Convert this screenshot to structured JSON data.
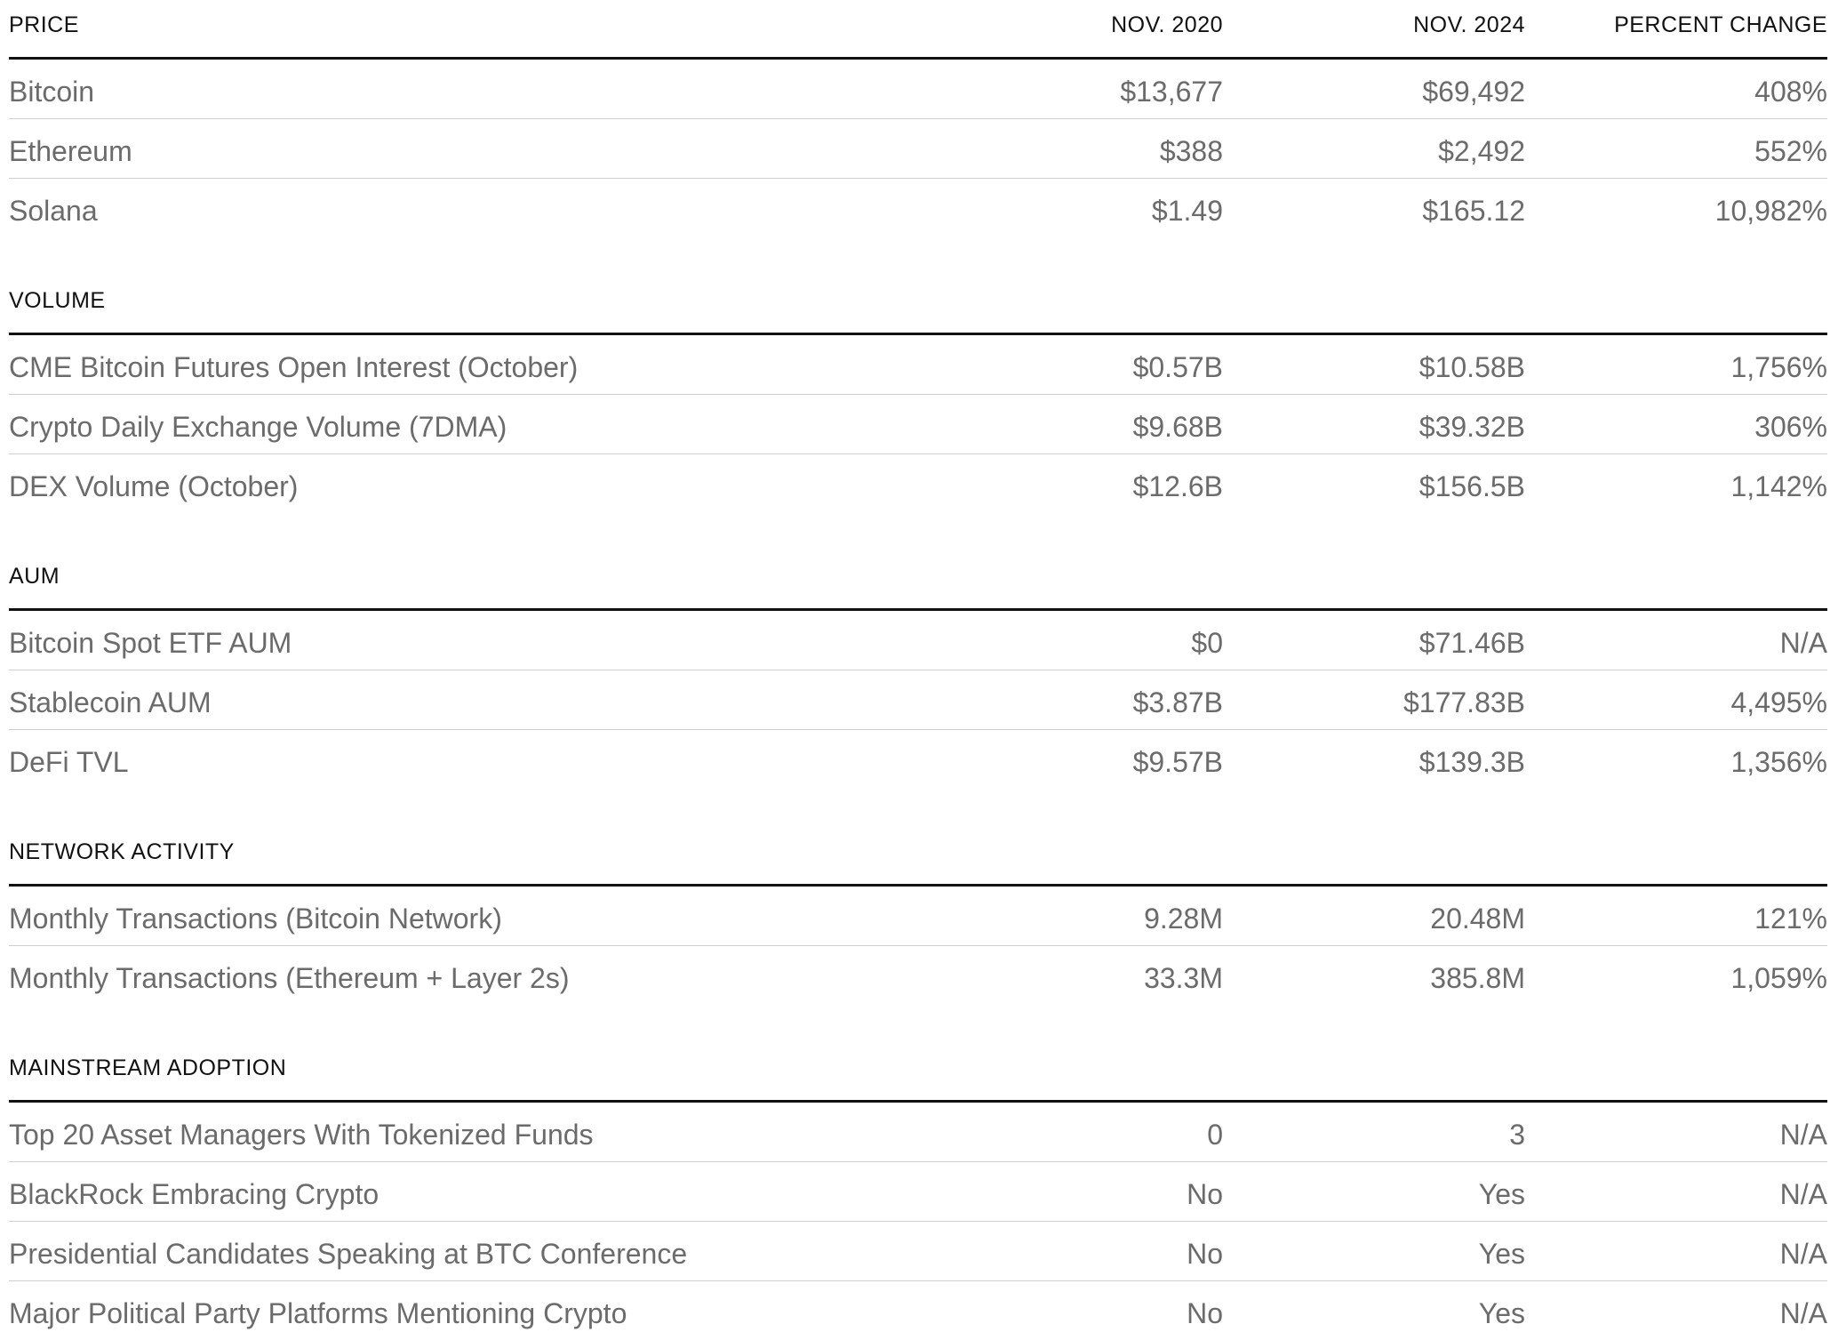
{
  "columns": {
    "nov2020": "NOV. 2020",
    "nov2024": "NOV. 2024",
    "percent_change": "PERCENT CHANGE"
  },
  "sections": [
    {
      "title": "PRICE",
      "rows": [
        {
          "label": "Bitcoin",
          "nov2020": "$13,677",
          "nov2024": "$69,492",
          "change": "408%"
        },
        {
          "label": "Ethereum",
          "nov2020": "$388",
          "nov2024": "$2,492",
          "change": "552%"
        },
        {
          "label": "Solana",
          "nov2020": "$1.49",
          "nov2024": "$165.12",
          "change": "10,982%"
        }
      ]
    },
    {
      "title": "VOLUME",
      "rows": [
        {
          "label": "CME Bitcoin Futures Open Interest (October)",
          "nov2020": "$0.57B",
          "nov2024": "$10.58B",
          "change": "1,756%"
        },
        {
          "label": "Crypto Daily Exchange Volume (7DMA)",
          "nov2020": "$9.68B",
          "nov2024": "$39.32B",
          "change": "306%"
        },
        {
          "label": "DEX Volume (October)",
          "nov2020": "$12.6B",
          "nov2024": "$156.5B",
          "change": "1,142%"
        }
      ]
    },
    {
      "title": "AUM",
      "rows": [
        {
          "label": "Bitcoin Spot ETF AUM",
          "nov2020": "$0",
          "nov2024": "$71.46B",
          "change": "N/A"
        },
        {
          "label": "Stablecoin AUM",
          "nov2020": "$3.87B",
          "nov2024": "$177.83B",
          "change": "4,495%"
        },
        {
          "label": "DeFi TVL",
          "nov2020": "$9.57B",
          "nov2024": "$139.3B",
          "change": "1,356%"
        }
      ]
    },
    {
      "title": "NETWORK ACTIVITY",
      "rows": [
        {
          "label": "Monthly Transactions (Bitcoin Network)",
          "nov2020": "9.28M",
          "nov2024": "20.48M",
          "change": "121%"
        },
        {
          "label": "Monthly Transactions (Ethereum + Layer 2s)",
          "nov2020": "33.3M",
          "nov2024": "385.8M",
          "change": "1,059%"
        }
      ]
    },
    {
      "title": "MAINSTREAM ADOPTION",
      "rows": [
        {
          "label": "Top 20 Asset Managers With Tokenized Funds",
          "nov2020": "0",
          "nov2024": "3",
          "change": "N/A"
        },
        {
          "label": "BlackRock Embracing Crypto",
          "nov2020": "No",
          "nov2024": "Yes",
          "change": "N/A"
        },
        {
          "label": "Presidential Candidates Speaking at BTC Conference",
          "nov2020": "No",
          "nov2024": "Yes",
          "change": "N/A"
        },
        {
          "label": "Major Political Party Platforms Mentioning Crypto",
          "nov2020": "No",
          "nov2024": "Yes",
          "change": "N/A"
        }
      ]
    }
  ]
}
